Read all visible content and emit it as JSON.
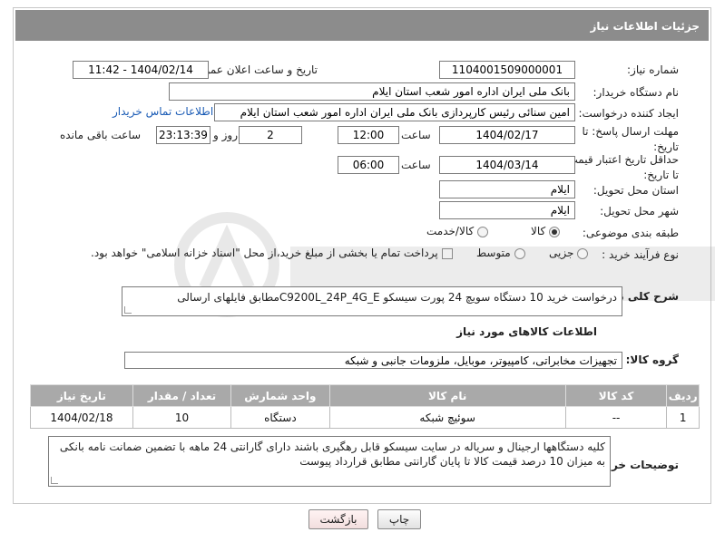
{
  "header": {
    "title": "جزئیات اطلاعات نیاز"
  },
  "fields": {
    "need_number_label": "شماره نیاز:",
    "need_number": "1104001509000001",
    "announce_label": "تاریخ و ساعت اعلان عمومی:",
    "announce_value": "1404/02/14 - 11:42",
    "buyer_org_label": "نام دستگاه خریدار:",
    "buyer_org": "بانک ملی ایران اداره امور شعب استان ایلام",
    "creator_label": "ایجاد کننده درخواست:",
    "creator": "امین سنائی رئیس کارپردازی بانک ملی ایران اداره امور شعب استان ایلام",
    "contact_link": "اطلاعات تماس خریدار",
    "reply_deadline_label": "مهلت ارسال پاسخ: تا تاریخ:",
    "reply_date": "1404/02/17",
    "time_label": "ساعت",
    "reply_time": "12:00",
    "days_count": "2",
    "days_label": "روز و",
    "remaining_time": "23:13:39",
    "remaining_label": "ساعت باقی مانده",
    "price_validity_label": "حداقل تاریخ اعتبار قیمت: تا تاریخ:",
    "price_date": "1404/03/14",
    "price_time": "06:00",
    "province_label": "استان محل تحویل:",
    "province": "ایلام",
    "city_label": "شهر محل تحویل:",
    "city": "ایلام",
    "category_label": "طبقه بندی موضوعی:",
    "category_goods": "کالا",
    "category_goods_service": "کالا/خدمت",
    "process_label": "نوع فرآیند خرید :",
    "process_partial": "جزیی",
    "process_medium": "متوسط",
    "payment_note": "پرداخت تمام یا بخشی از مبلغ خرید،از محل \"اسناد خزانه اسلامی\" خواهد بود."
  },
  "description": {
    "label": "شرح کلی نیاز:",
    "text": "درخواست خرید 10 دستگاه سویچ 24 پورت  سیسکو C9200L_24P_4G_Eمطابق فایلهای ارسالی"
  },
  "goods_section": {
    "title": "اطلاعات کالاهای مورد نیاز",
    "group_label": "گروه کالا:",
    "group_value": "تجهیزات مخابراتی، کامپیوتر، موبایل، ملزومات جانبی و شبکه"
  },
  "table": {
    "headers": [
      "ردیف",
      "کد کالا",
      "نام کالا",
      "واحد شمارش",
      "تعداد / مقدار",
      "تاریخ نیاز"
    ],
    "rows": [
      [
        "1",
        "--",
        "سوئیچ شبکه",
        "دستگاه",
        "10",
        "1404/02/18"
      ]
    ]
  },
  "buyer_notes": {
    "label": "توضیحات خریدار:",
    "text": "کلیه دستگاهها ارجینال و سریاله در سایت سیسکو قابل رهگیری باشند  دارای گارانتی 24 ماهه با تضمین ضمانت نامه بانکی به میزان 10 درصد قیمت کالا تا پایان گارانتی  مطابق قرارداد پیوست"
  },
  "buttons": {
    "print": "چاپ",
    "back": "بازگشت"
  },
  "colors": {
    "header_bg": "#8c8c8c",
    "table_header_bg": "#a9a9a9",
    "link": "#1a5bb5"
  }
}
